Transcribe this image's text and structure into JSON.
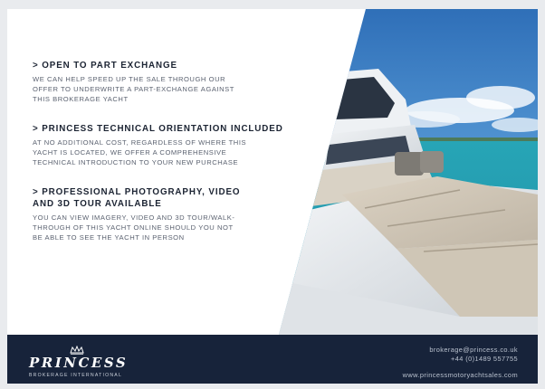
{
  "offers": [
    {
      "heading": "> OPEN TO PART EXCHANGE",
      "body": "WE CAN HELP SPEED UP THE SALE THROUGH OUR\nOFFER TO UNDERWRITE A PART-EXCHANGE AGAINST\nTHIS BROKERAGE YACHT"
    },
    {
      "heading": "> PRINCESS TECHNICAL ORIENTATION INCLUDED",
      "body": "AT NO ADDITIONAL COST, REGARDLESS OF WHERE THIS\nYACHT IS LOCATED, WE OFFER A COMPREHENSIVE\nTECHNICAL INTRODUCTION TO YOUR NEW PURCHASE"
    },
    {
      "heading": "> PROFESSIONAL PHOTOGRAPHY, VIDEO\nAND 3D TOUR AVAILABLE",
      "body": "YOU CAN VIEW IMAGERY, VIDEO AND 3D TOUR/WALK-\nTHROUGH OF THIS YACHT ONLINE SHOULD YOU NOT\nBE ABLE TO SEE THE YACHT IN PERSON"
    }
  ],
  "footer": {
    "brand": "PRINCESS",
    "brand_sub": "BROKERAGE INTERNATIONAL",
    "email": "brokerage@princess.co.uk",
    "phone": "+44 (0)1489 557755",
    "website": "www.princessmotoryachtsales.com"
  },
  "photo": {
    "subject": "yacht-deck-sunpad-image"
  },
  "colors": {
    "footer_bg": "#17233a",
    "heading": "#1c2433",
    "body": "#5b6270",
    "sky": "#3f86c8",
    "sea": "#2aa3b5"
  }
}
